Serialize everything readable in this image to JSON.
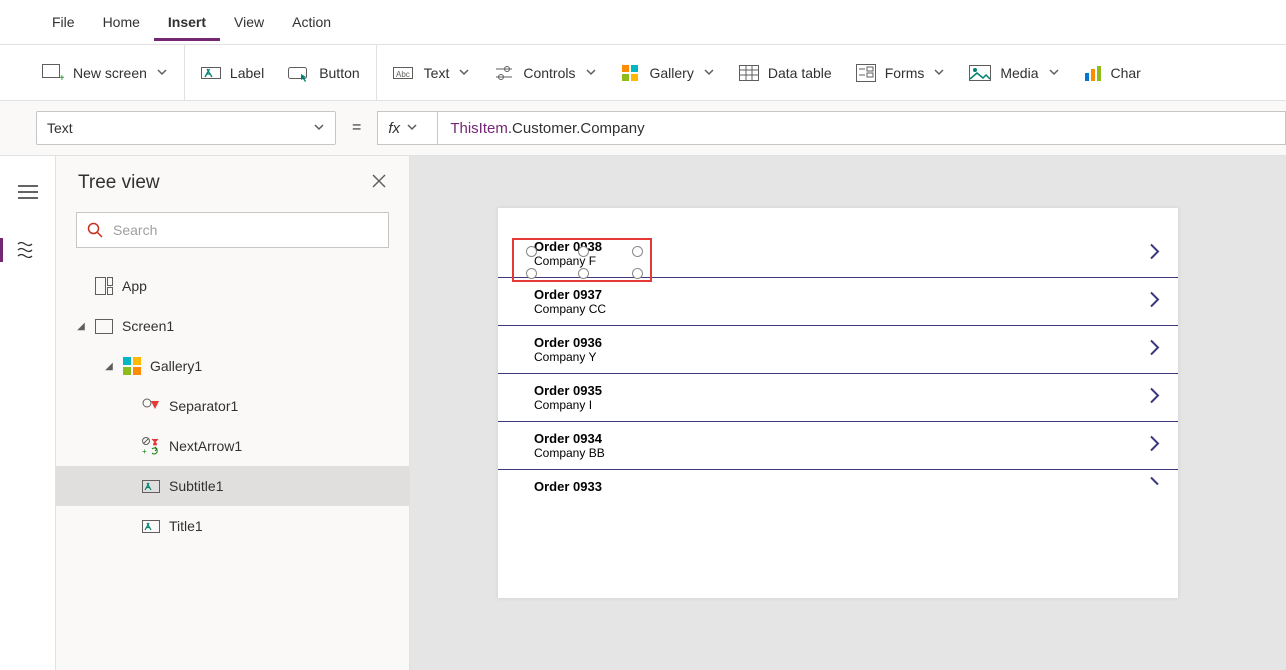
{
  "menubar": [
    "File",
    "Home",
    "Insert",
    "View",
    "Action"
  ],
  "menubar_active": 2,
  "ribbon": {
    "new_screen": "New screen",
    "label": "Label",
    "button": "Button",
    "text": "Text",
    "controls": "Controls",
    "gallery": "Gallery",
    "data_table": "Data table",
    "forms": "Forms",
    "media": "Media",
    "charts": "Char"
  },
  "formula": {
    "property": "Text",
    "fx": "fx",
    "expression_var": "ThisItem",
    "expression_rest": ".Customer.Company"
  },
  "tree": {
    "title": "Tree view",
    "search_placeholder": "Search",
    "nodes": {
      "app": "App",
      "screen1": "Screen1",
      "gallery1": "Gallery1",
      "separator1": "Separator1",
      "nextarrow1": "NextArrow1",
      "subtitle1": "Subtitle1",
      "title1": "Title1"
    }
  },
  "gallery_items": [
    {
      "title": "Order 0938",
      "subtitle": "Company F"
    },
    {
      "title": "Order 0937",
      "subtitle": "Company CC"
    },
    {
      "title": "Order 0936",
      "subtitle": "Company Y"
    },
    {
      "title": "Order 0935",
      "subtitle": "Company I"
    },
    {
      "title": "Order 0934",
      "subtitle": "Company BB"
    },
    {
      "title": "Order 0933",
      "subtitle": ""
    }
  ]
}
